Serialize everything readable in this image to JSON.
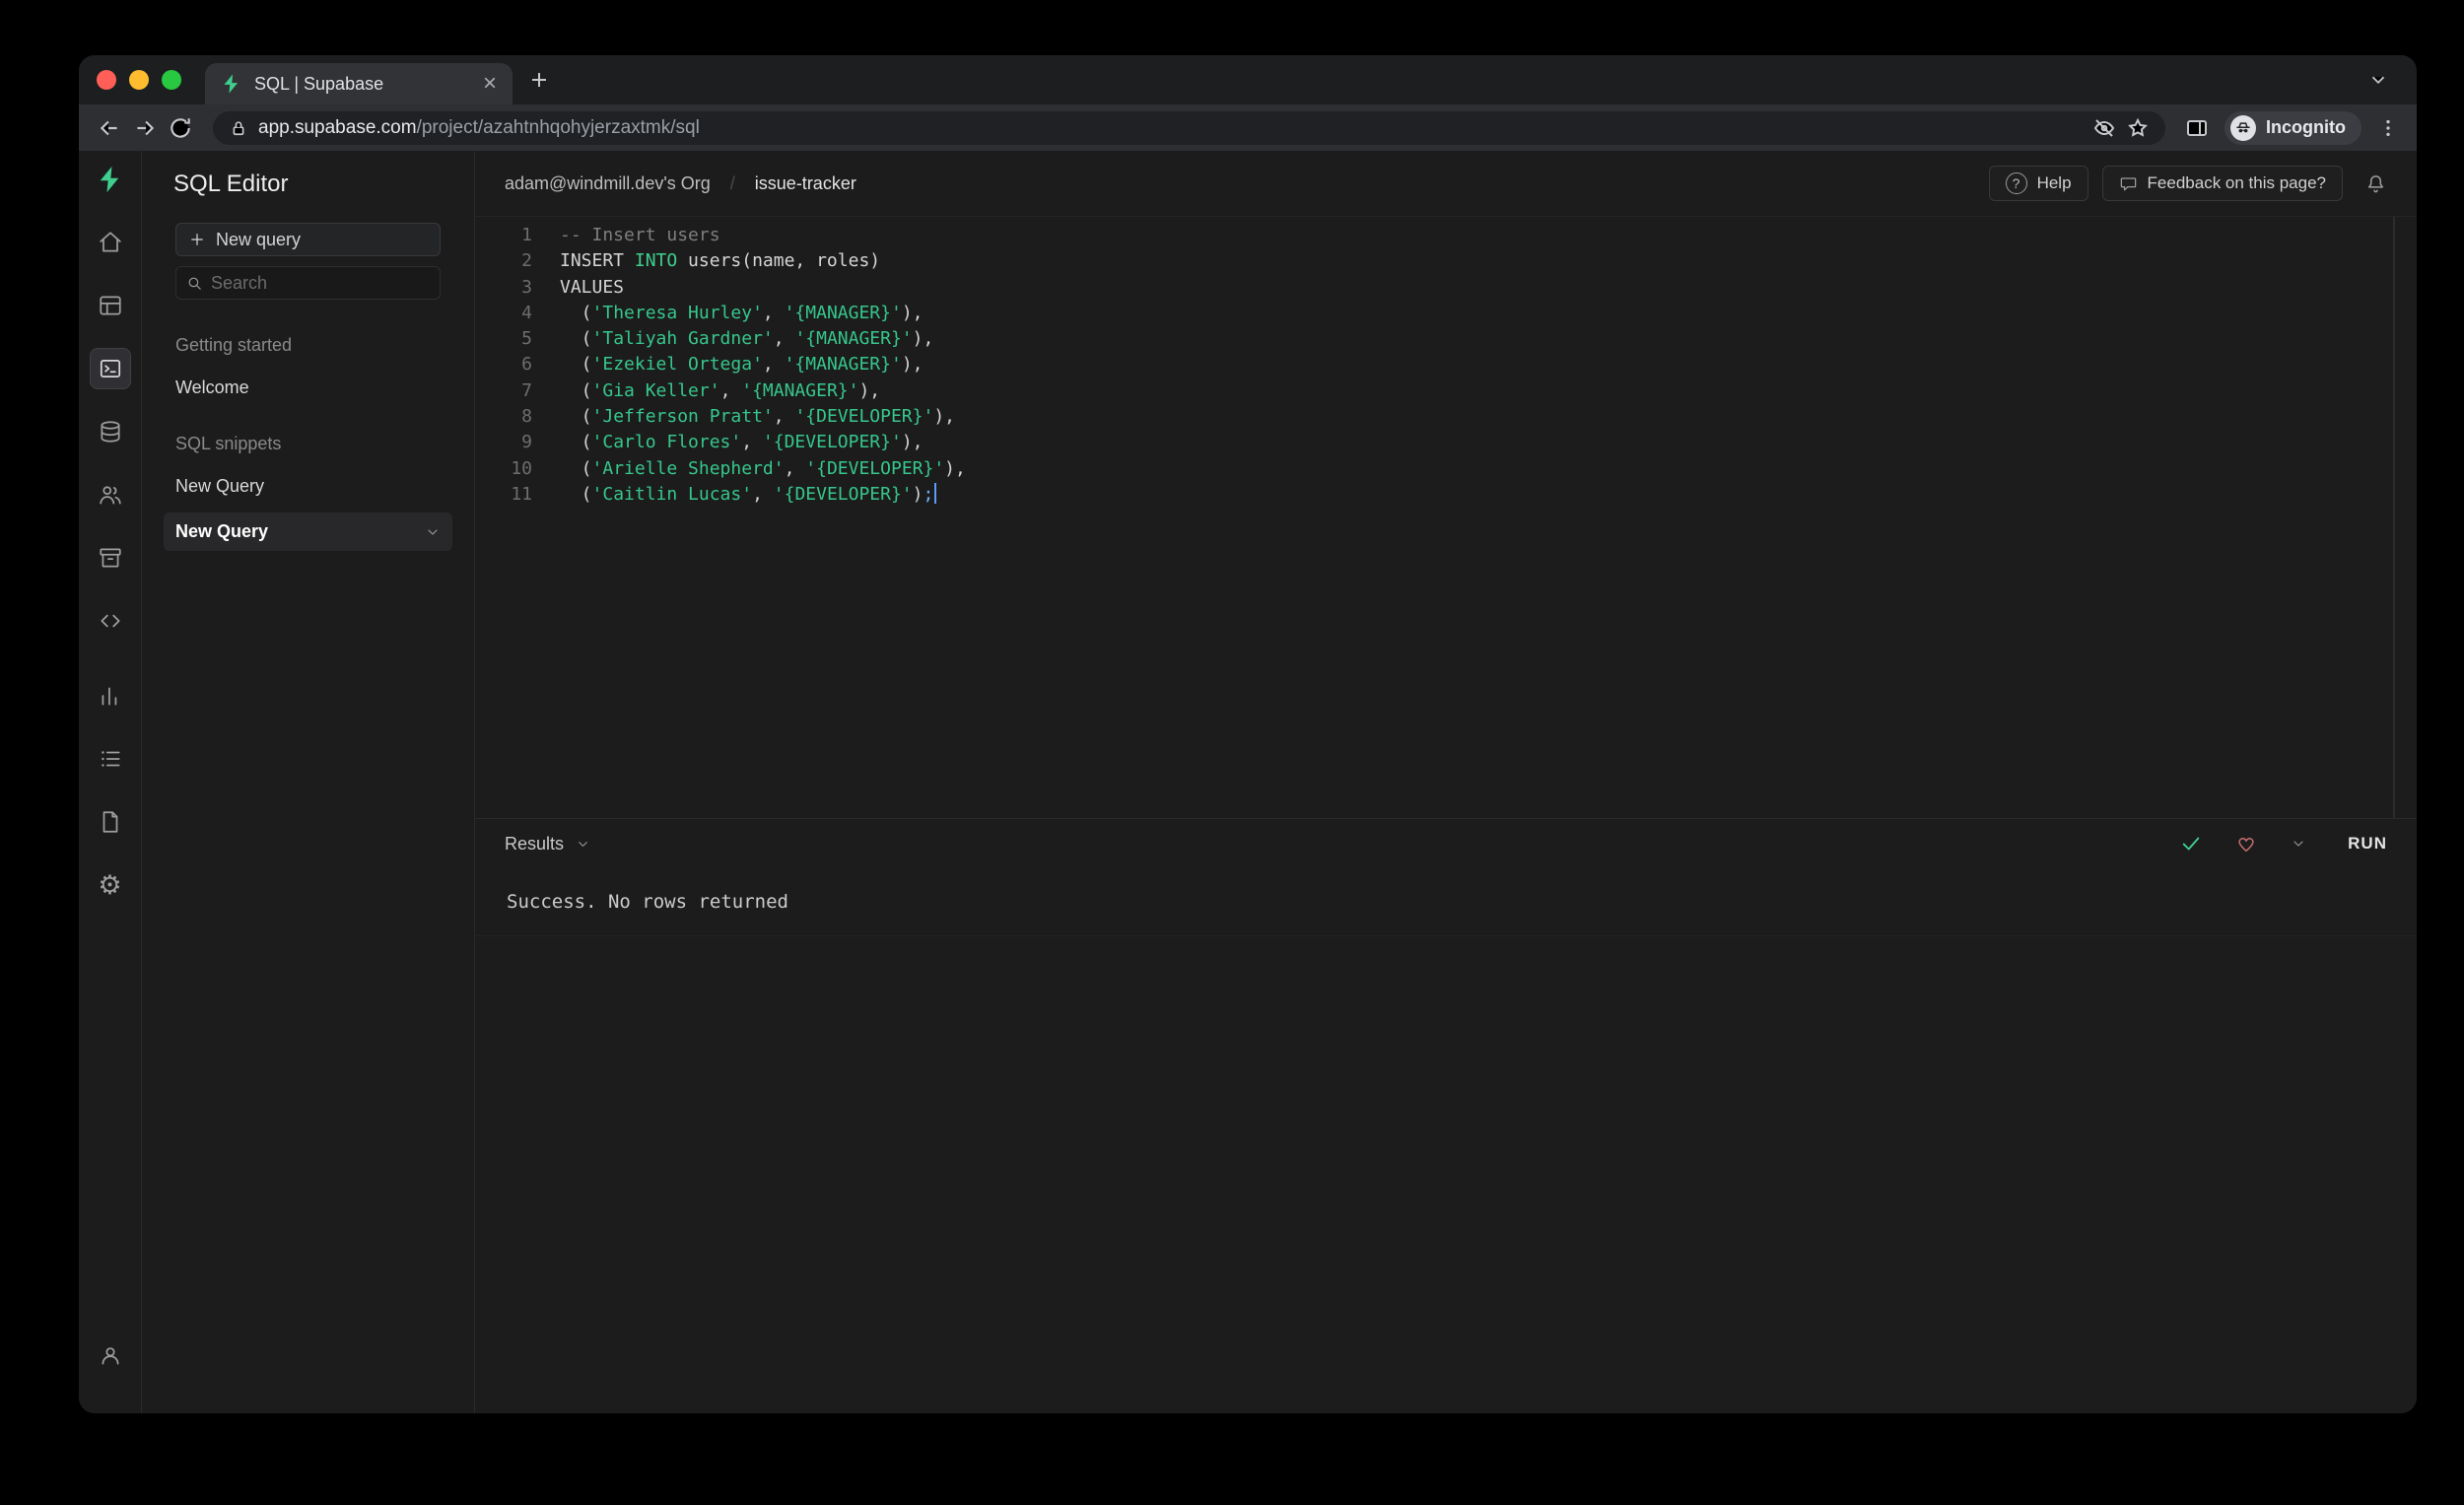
{
  "browser": {
    "tab_title": "SQL | Supabase",
    "url_domain": "app.supabase.com",
    "url_path": "/project/azahtnhqohyjerzaxtmk/sql",
    "incognito_label": "Incognito"
  },
  "sidebar": {
    "title": "SQL Editor",
    "new_query_button": "New query",
    "search_placeholder": "Search",
    "sections": [
      {
        "label": "Getting started",
        "items": [
          "Welcome"
        ]
      },
      {
        "label": "SQL snippets",
        "items": [
          "New Query",
          "New Query"
        ]
      }
    ]
  },
  "header": {
    "org": "adam@windmill.dev's Org",
    "separator": "/",
    "project": "issue-tracker",
    "help_label": "Help",
    "feedback_label": "Feedback on this page?"
  },
  "editor": {
    "cursor_line": 11,
    "lines": [
      [
        [
          "comment",
          "-- Insert users"
        ]
      ],
      [
        [
          "plain",
          "INSERT "
        ],
        [
          "keyword",
          "INTO"
        ],
        [
          "plain",
          " users(name, roles)"
        ]
      ],
      [
        [
          "plain",
          "VALUES"
        ]
      ],
      [
        [
          "plain",
          "  ("
        ],
        [
          "string",
          "'Theresa Hurley'"
        ],
        [
          "plain",
          ", "
        ],
        [
          "string",
          "'{MANAGER}'"
        ],
        [
          "plain",
          "),"
        ]
      ],
      [
        [
          "plain",
          "  ("
        ],
        [
          "string",
          "'Taliyah Gardner'"
        ],
        [
          "plain",
          ", "
        ],
        [
          "string",
          "'{MANAGER}'"
        ],
        [
          "plain",
          "),"
        ]
      ],
      [
        [
          "plain",
          "  ("
        ],
        [
          "string",
          "'Ezekiel Ortega'"
        ],
        [
          "plain",
          ", "
        ],
        [
          "string",
          "'{MANAGER}'"
        ],
        [
          "plain",
          "),"
        ]
      ],
      [
        [
          "plain",
          "  ("
        ],
        [
          "string",
          "'Gia Keller'"
        ],
        [
          "plain",
          ", "
        ],
        [
          "string",
          "'{MANAGER}'"
        ],
        [
          "plain",
          "),"
        ]
      ],
      [
        [
          "plain",
          "  ("
        ],
        [
          "string",
          "'Jefferson Pratt'"
        ],
        [
          "plain",
          ", "
        ],
        [
          "string",
          "'{DEVELOPER}'"
        ],
        [
          "plain",
          "),"
        ]
      ],
      [
        [
          "plain",
          "  ("
        ],
        [
          "string",
          "'Carlo Flores'"
        ],
        [
          "plain",
          ", "
        ],
        [
          "string",
          "'{DEVELOPER}'"
        ],
        [
          "plain",
          "),"
        ]
      ],
      [
        [
          "plain",
          "  ("
        ],
        [
          "string",
          "'Arielle Shepherd'"
        ],
        [
          "plain",
          ", "
        ],
        [
          "string",
          "'{DEVELOPER}'"
        ],
        [
          "plain",
          "),"
        ]
      ],
      [
        [
          "plain",
          "  ("
        ],
        [
          "string",
          "'Caitlin Lucas'"
        ],
        [
          "plain",
          ", "
        ],
        [
          "string",
          "'{DEVELOPER}'"
        ],
        [
          "plain",
          ")"
        ],
        [
          "accent",
          ";"
        ]
      ]
    ]
  },
  "results": {
    "tab_label": "Results",
    "run_label": "RUN",
    "message": "Success. No rows returned"
  },
  "colors": {
    "accent": "#3ecf8e"
  }
}
